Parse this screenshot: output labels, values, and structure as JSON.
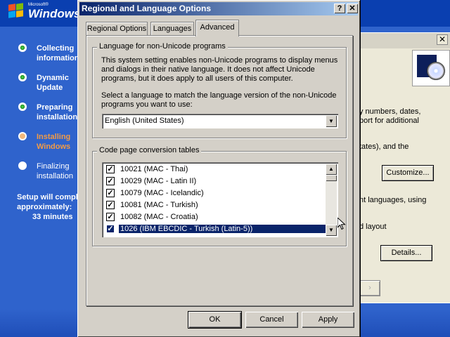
{
  "setup": {
    "logo_small": "Microsoft®",
    "logo_word": "Windows",
    "steps": [
      {
        "label": "Collecting information",
        "state": "done"
      },
      {
        "label": "Dynamic Update",
        "state": "done"
      },
      {
        "label": "Preparing installation",
        "state": "done"
      },
      {
        "label": "Installing Windows",
        "state": "current"
      },
      {
        "label": "Finalizing installation",
        "state": "todo"
      }
    ],
    "time_line1": "Setup will complete in",
    "time_line2": "approximately:",
    "time_line3": "33 minutes"
  },
  "background_window": {
    "close_glyph": "✕",
    "text1": "y numbers, dates,",
    "text2": "port for additional",
    "text3": "tates), and the",
    "customize_label": "Customize...",
    "text4": "nt languages, using",
    "text5": "d layout",
    "details_label": "Details..."
  },
  "dialog": {
    "title": "Regional and Language Options",
    "help_glyph": "?",
    "close_glyph": "✕",
    "tabs": [
      "Regional Options",
      "Languages",
      "Advanced"
    ],
    "active_tab": "Advanced",
    "non_unicode": {
      "group_title": "Language for non-Unicode programs",
      "description": "This system setting enables non-Unicode programs to display menus and dialogs in their native language. It does not affect Unicode programs, but it does apply to all users of this computer.",
      "prompt": "Select a language to match the language version of the non-Unicode programs you want to use:",
      "selected_language": "English (United States)"
    },
    "code_page": {
      "group_title": "Code page conversion tables",
      "items": [
        {
          "label": "10021  (MAC - Thai)",
          "checked": true
        },
        {
          "label": "10029  (MAC - Latin II)",
          "checked": true
        },
        {
          "label": "10079  (MAC - Icelandic)",
          "checked": true
        },
        {
          "label": "10081  (MAC - Turkish)",
          "checked": true
        },
        {
          "label": "10082  (MAC - Croatia)",
          "checked": true
        },
        {
          "label": "1026  (IBM EBCDIC - Turkish (Latin-5))",
          "checked": true,
          "selected": true
        }
      ]
    },
    "buttons": {
      "ok": "OK",
      "cancel": "Cancel",
      "apply": "Apply"
    }
  },
  "icons": [
    "windows-flag-icon",
    "step-done-icon",
    "step-current-icon",
    "step-todo-icon",
    "checkbox-icon",
    "scroll-up-icon",
    "scroll-down-icon",
    "dropdown-arrow-icon",
    "mouse-cursor-icon"
  ],
  "colors": {
    "title_start": "#0a246a",
    "title_end": "#a6caf0",
    "selection": "#0a246a",
    "setup_blue": "#2f63cc",
    "current_step": "#f29b45"
  }
}
